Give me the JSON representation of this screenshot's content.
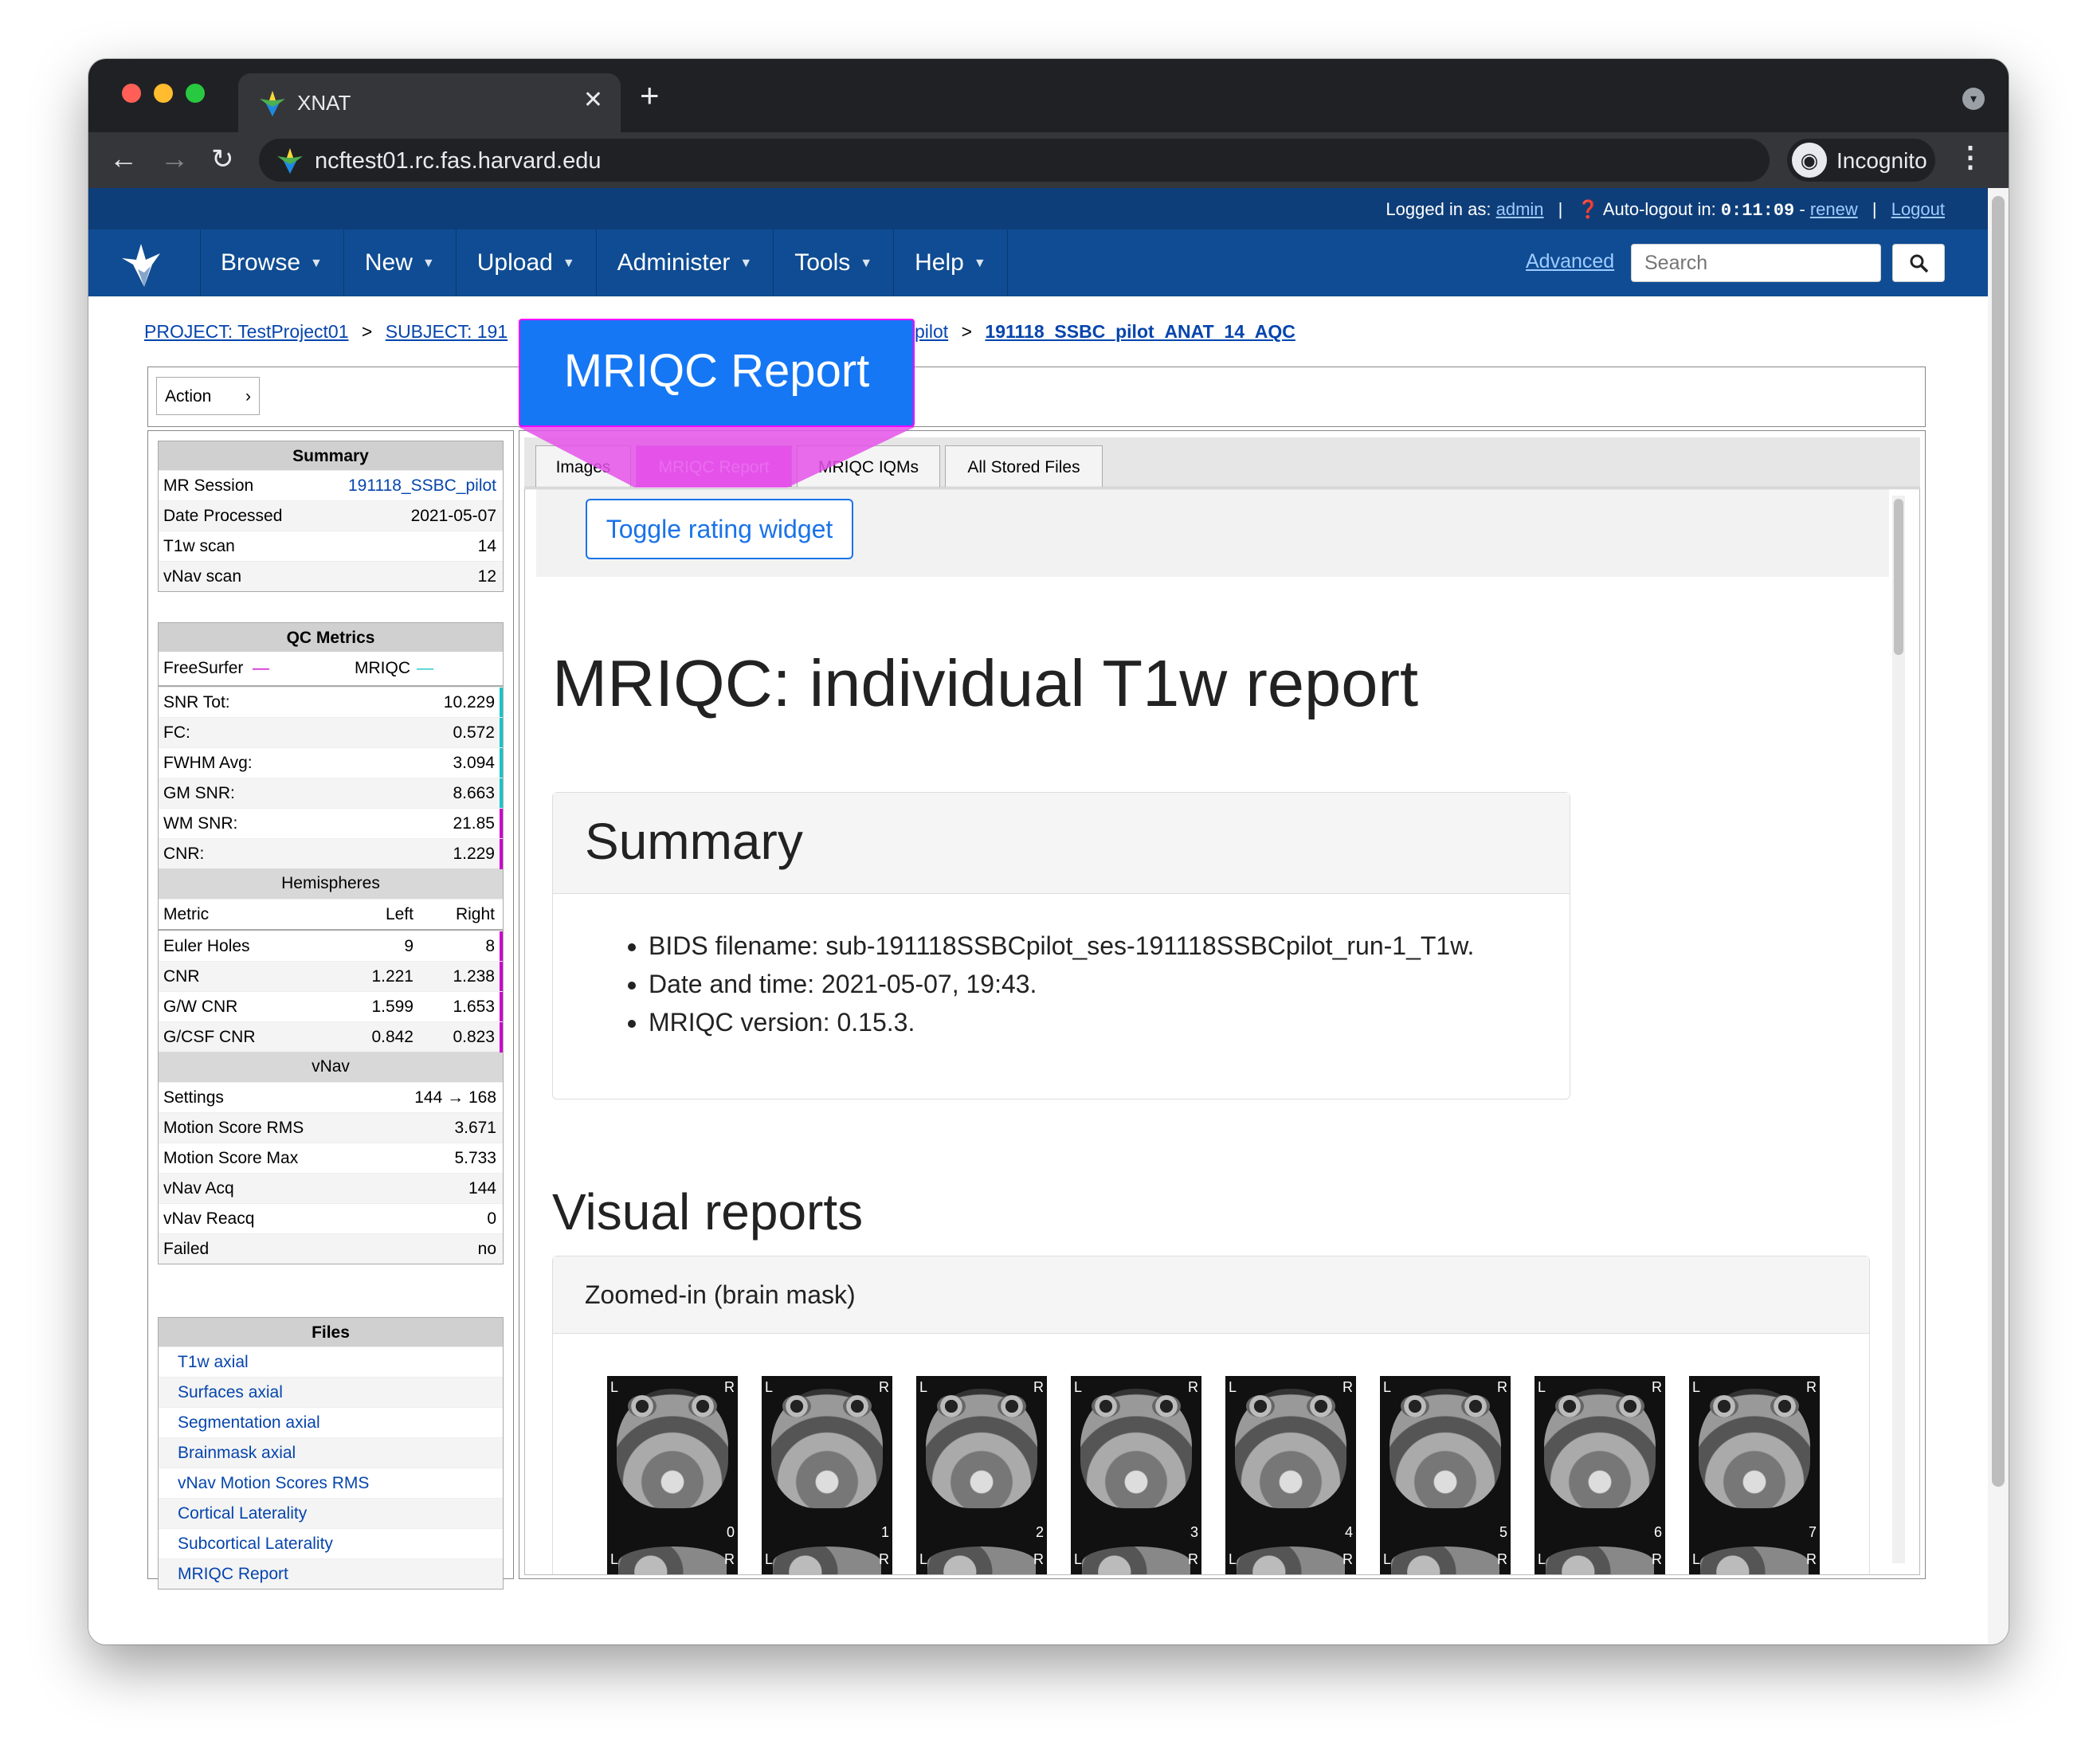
{
  "browser": {
    "tab_title": "XNAT",
    "url": "ncftest01.rc.fas.harvard.edu",
    "incognito_label": "Incognito"
  },
  "topbar": {
    "logged_in_label": "Logged in as:",
    "user": "admin",
    "autologout_label": "Auto-logout in:",
    "timer": "0:11:09",
    "renew": "renew",
    "logout": "Logout"
  },
  "nav": {
    "items": [
      "Browse",
      "New",
      "Upload",
      "Administer",
      "Tools",
      "Help"
    ],
    "advanced": "Advanced",
    "search_placeholder": "Search"
  },
  "breadcrumb": {
    "project": "PROJECT: TestProject01",
    "subject": "SUBJECT: 191",
    "session_tail": "pilot",
    "current": "191118_SSBC_pilot_ANAT_14_AQC",
    "sep": ">"
  },
  "action": {
    "label": "Action"
  },
  "callout": {
    "label": "MRIQC Report",
    "color": "#1577f4",
    "highlight": "#e552ea"
  },
  "summary": {
    "title": "Summary",
    "rows": [
      {
        "label": "MR Session",
        "value": "191118_SSBC_pilot"
      },
      {
        "label": "Date Processed",
        "value": "2021-05-07"
      },
      {
        "label": "T1w scan",
        "value": "14"
      },
      {
        "label": "vNav scan",
        "value": "12"
      }
    ]
  },
  "qc": {
    "title": "QC Metrics",
    "freesurfer_label": "FreeSurfer",
    "mriqc_label": "MRIQC",
    "freesurfer_color": "#cc00cc",
    "mriqc_color": "#19c6c6",
    "metrics": [
      {
        "label": "SNR Tot:",
        "value": "10.229",
        "source": "mriqc"
      },
      {
        "label": "FC:",
        "value": "0.572",
        "source": "mriqc"
      },
      {
        "label": "FWHM Avg:",
        "value": "3.094",
        "source": "mriqc"
      },
      {
        "label": "GM SNR:",
        "value": "8.663",
        "source": "mriqc"
      },
      {
        "label": "WM SNR:",
        "value": "21.85",
        "source": "freesurfer"
      },
      {
        "label": "CNR:",
        "value": "1.229",
        "source": "freesurfer"
      }
    ],
    "hemispheres_title": "Hemispheres",
    "hemi_headers": [
      "Metric",
      "Left",
      "Right"
    ],
    "hemi_rows": [
      {
        "label": "Euler Holes",
        "left": "9",
        "right": "8"
      },
      {
        "label": "CNR",
        "left": "1.221",
        "right": "1.238"
      },
      {
        "label": "G/W CNR",
        "left": "1.599",
        "right": "1.653"
      },
      {
        "label": "G/CSF CNR",
        "left": "0.842",
        "right": "0.823"
      }
    ],
    "vnav_title": "vNav",
    "vnav_rows": [
      {
        "label": "Settings",
        "value": "144 → 168"
      },
      {
        "label": "Motion Score RMS",
        "value": "3.671"
      },
      {
        "label": "Motion Score Max",
        "value": "5.733"
      },
      {
        "label": "vNav Acq",
        "value": "144"
      },
      {
        "label": "vNav Reacq",
        "value": "0"
      },
      {
        "label": "Failed",
        "value": "no"
      }
    ]
  },
  "files": {
    "title": "Files",
    "items": [
      "T1w axial",
      "Surfaces axial",
      "Segmentation axial",
      "Brainmask axial",
      "vNav Motion Scores RMS",
      "Cortical Laterality",
      "Subcortical Laterality",
      "MRIQC Report"
    ]
  },
  "tabs": [
    "Images",
    "MRIQC Report",
    "MRIQC IQMs",
    "All Stored Files"
  ],
  "report": {
    "toggle": "Toggle rating widget",
    "title": "MRIQC: individual T1w report",
    "summary_title": "Summary",
    "bullets": [
      "BIDS filename: sub-191118SSBCpilot_ses-191118SSBCpilot_run-1_T1w.",
      "Date and time: 2021-05-07, 19:43.",
      "MRIQC version: 0.15.3."
    ],
    "visual_title": "Visual reports",
    "zoom_title": "Zoomed-in (brain mask)",
    "slice_numbers": [
      "0",
      "1",
      "2",
      "3",
      "4",
      "5",
      "6",
      "7"
    ],
    "orient_left": "L",
    "orient_right": "R"
  }
}
